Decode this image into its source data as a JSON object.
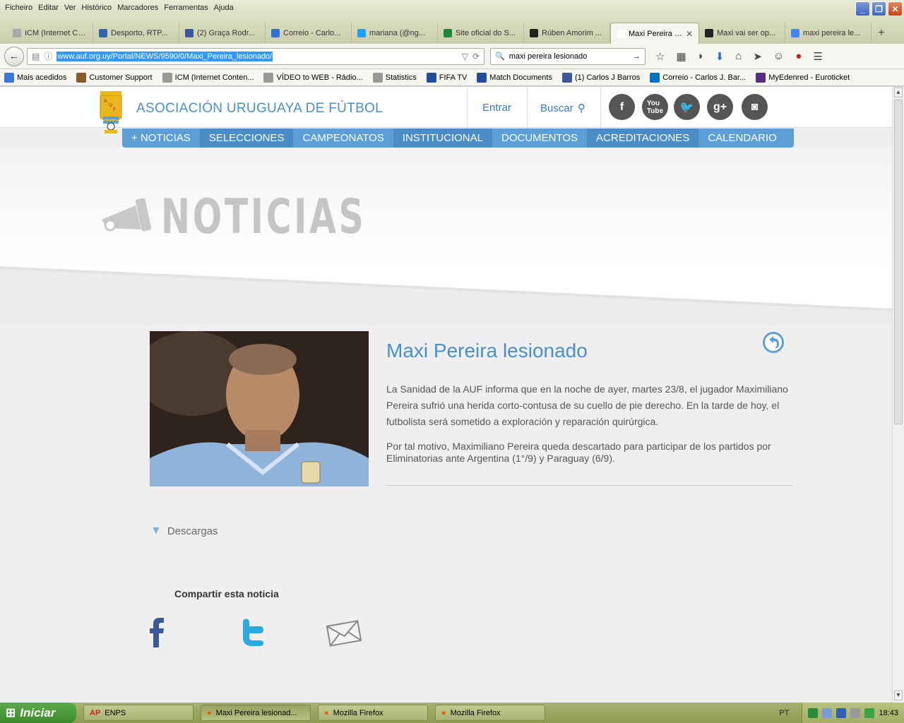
{
  "menubar": [
    "Ficheiro",
    "Editar",
    "Ver",
    "Histórico",
    "Marcadores",
    "Ferramentas",
    "Ajuda"
  ],
  "tabs": [
    {
      "label": "ICM (Internet Cont...",
      "color": "#aaaaaa"
    },
    {
      "label": "Desporto, RTP...",
      "color": "#3366aa"
    },
    {
      "label": "(2) Graça Rodr...",
      "color": "#3b5998"
    },
    {
      "label": "Correio - Carlo...",
      "color": "#2f6fd6"
    },
    {
      "label": "mariana (@ng...",
      "color": "#1da1f2"
    },
    {
      "label": "Site oficial do S...",
      "color": "#1b8a3a"
    },
    {
      "label": "Rúben Amorim ...",
      "color": "#222222"
    },
    {
      "label": "Maxi Pereira les...",
      "color": "#ffffff",
      "active": true
    },
    {
      "label": "Maxi vai ser op...",
      "color": "#222222"
    },
    {
      "label": "maxi pereira le...",
      "color": "#4285f4"
    }
  ],
  "url": "www.auf.org.uy/Portal/NEWS/9590/0/Maxi_Pereira_lesionado/",
  "search_value": "maxi pereira lesionado",
  "bookmarks": [
    {
      "label": "Mais acedidos",
      "color": "#3c78d8"
    },
    {
      "label": "Customer Support",
      "color": "#8b5a2b"
    },
    {
      "label": "ICM (Internet Conten...",
      "color": "#999999"
    },
    {
      "label": "VÍDEO to WEB - Rádio...",
      "color": "#999999"
    },
    {
      "label": "Statistics",
      "color": "#999999"
    },
    {
      "label": "FIFA TV",
      "color": "#1f4f9c"
    },
    {
      "label": "Match Documents",
      "color": "#1f4f9c"
    },
    {
      "label": "(1) Carlos J Barros",
      "color": "#3b5998"
    },
    {
      "label": "Correio - Carlos J. Bar...",
      "color": "#0072c6"
    },
    {
      "label": "MyEdenred - Euroticket",
      "color": "#5b2c83"
    }
  ],
  "site": {
    "brand": "ASOCIACIÓN URUGUAYA DE FÚTBOL",
    "entrar": "Entrar",
    "buscar": "Buscar",
    "nav": [
      "+ NOTICIAS",
      "SELECCIONES",
      "CAMPEONATOS",
      "INSTITUCIONAL",
      "DOCUMENTOS",
      "ACREDITACIONES",
      "CALENDARIO"
    ],
    "section": "NOTICIAS"
  },
  "article": {
    "title": "Maxi Pereira lesionado",
    "p1": "La Sanidad de la AUF informa que en la noche de ayer, martes 23/8, el jugador Maximiliano Pereira sufrió una herida corto-contusa de su cuello de pie derecho. En la tarde de hoy, el futbolista será sometido a exploración y reparación quirúrgica.",
    "p2": "Por tal motivo, Maximiliano Pereira queda descartado para participar de los partidos por Eliminatorias ante Argentina (1°/9) y Paraguay (6/9).",
    "descargas": "Descargas",
    "compartir": "Compartir esta noticia"
  },
  "taskbar": {
    "start": "Iniciar",
    "tasks": [
      "ENPS",
      "Maxi Pereira lesionad...",
      "Mozilla Firefox",
      "Mozilla Firefox"
    ],
    "lang": "PT",
    "clock": "18:43"
  }
}
